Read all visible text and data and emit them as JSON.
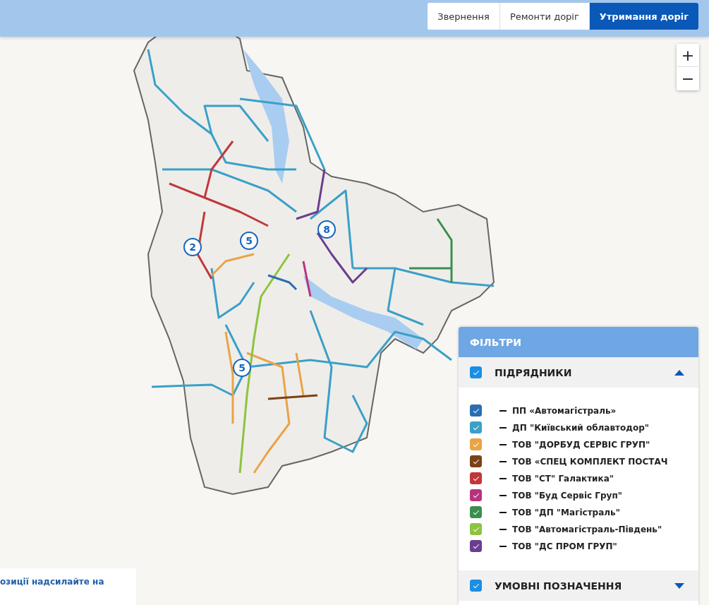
{
  "tabs": [
    {
      "label": "Звернення",
      "selected": false
    },
    {
      "label": "Ремонти доріг",
      "selected": false
    },
    {
      "label": "Утримання доріг",
      "selected": true
    }
  ],
  "zoom": {
    "plus": "+",
    "minus": "−"
  },
  "map": {
    "clusters": [
      {
        "count": "2"
      },
      {
        "count": "5"
      },
      {
        "count": "8"
      },
      {
        "count": "5"
      }
    ]
  },
  "filters": {
    "title": "ФІЛЬТРИ",
    "sections": [
      {
        "title": "ПІДРЯДНИКИ",
        "checked": true,
        "expanded": true,
        "items": [
          {
            "label": "ПП «Автомагістраль»",
            "color": "#2a6db0",
            "checked": true
          },
          {
            "label": "ДП \"Київський облавтодор\"",
            "color": "#3aa0c8",
            "checked": true
          },
          {
            "label": "ТОВ \"ДОРБУД СЕРВІС ГРУП\"",
            "color": "#e9a445",
            "checked": true
          },
          {
            "label": "ТОВ «СПЕЦ КОМПЛЕКТ ПОСТАЧ",
            "color": "#7a4216",
            "checked": true
          },
          {
            "label": "ТОВ \"СТ\" Галактика\"",
            "color": "#c0383a",
            "checked": true
          },
          {
            "label": "ТОВ \"Буд Сервіс Груп\"",
            "color": "#b8337e",
            "checked": true
          },
          {
            "label": "ТОВ \"ДП \"Магістраль\"",
            "color": "#3a8f4e",
            "checked": true
          },
          {
            "label": "ТОВ \"Автомагістраль-Південь\"",
            "color": "#8cc43f",
            "checked": true
          },
          {
            "label": "ТОВ \"ДС ПРОМ ГРУП\"",
            "color": "#6a3e8e",
            "checked": true
          }
        ]
      },
      {
        "title": "УМОВНІ ПОЗНАЧЕННЯ",
        "checked": true,
        "expanded": false
      }
    ]
  },
  "notice": {
    "text": "озиції надсилайте на"
  }
}
